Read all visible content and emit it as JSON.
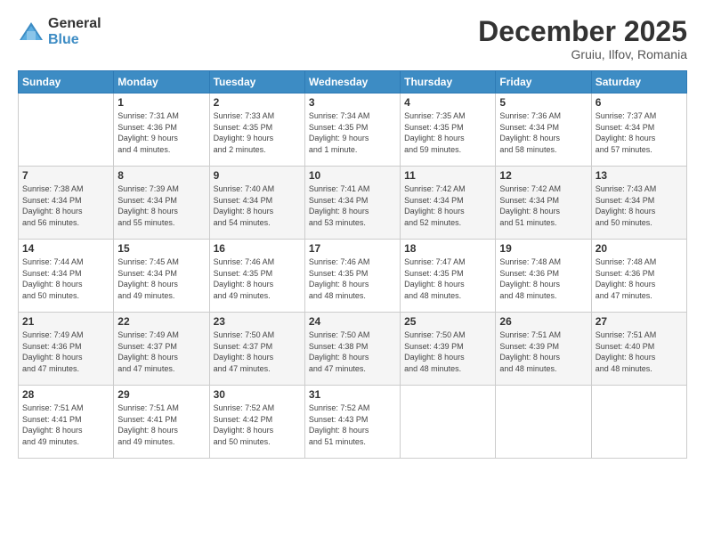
{
  "logo": {
    "general": "General",
    "blue": "Blue"
  },
  "header": {
    "month": "December 2025",
    "location": "Gruiu, Ilfov, Romania"
  },
  "weekdays": [
    "Sunday",
    "Monday",
    "Tuesday",
    "Wednesday",
    "Thursday",
    "Friday",
    "Saturday"
  ],
  "weeks": [
    [
      {
        "day": "",
        "info": ""
      },
      {
        "day": "1",
        "info": "Sunrise: 7:31 AM\nSunset: 4:36 PM\nDaylight: 9 hours\nand 4 minutes."
      },
      {
        "day": "2",
        "info": "Sunrise: 7:33 AM\nSunset: 4:35 PM\nDaylight: 9 hours\nand 2 minutes."
      },
      {
        "day": "3",
        "info": "Sunrise: 7:34 AM\nSunset: 4:35 PM\nDaylight: 9 hours\nand 1 minute."
      },
      {
        "day": "4",
        "info": "Sunrise: 7:35 AM\nSunset: 4:35 PM\nDaylight: 8 hours\nand 59 minutes."
      },
      {
        "day": "5",
        "info": "Sunrise: 7:36 AM\nSunset: 4:34 PM\nDaylight: 8 hours\nand 58 minutes."
      },
      {
        "day": "6",
        "info": "Sunrise: 7:37 AM\nSunset: 4:34 PM\nDaylight: 8 hours\nand 57 minutes."
      }
    ],
    [
      {
        "day": "7",
        "info": "Sunrise: 7:38 AM\nSunset: 4:34 PM\nDaylight: 8 hours\nand 56 minutes."
      },
      {
        "day": "8",
        "info": "Sunrise: 7:39 AM\nSunset: 4:34 PM\nDaylight: 8 hours\nand 55 minutes."
      },
      {
        "day": "9",
        "info": "Sunrise: 7:40 AM\nSunset: 4:34 PM\nDaylight: 8 hours\nand 54 minutes."
      },
      {
        "day": "10",
        "info": "Sunrise: 7:41 AM\nSunset: 4:34 PM\nDaylight: 8 hours\nand 53 minutes."
      },
      {
        "day": "11",
        "info": "Sunrise: 7:42 AM\nSunset: 4:34 PM\nDaylight: 8 hours\nand 52 minutes."
      },
      {
        "day": "12",
        "info": "Sunrise: 7:42 AM\nSunset: 4:34 PM\nDaylight: 8 hours\nand 51 minutes."
      },
      {
        "day": "13",
        "info": "Sunrise: 7:43 AM\nSunset: 4:34 PM\nDaylight: 8 hours\nand 50 minutes."
      }
    ],
    [
      {
        "day": "14",
        "info": "Sunrise: 7:44 AM\nSunset: 4:34 PM\nDaylight: 8 hours\nand 50 minutes."
      },
      {
        "day": "15",
        "info": "Sunrise: 7:45 AM\nSunset: 4:34 PM\nDaylight: 8 hours\nand 49 minutes."
      },
      {
        "day": "16",
        "info": "Sunrise: 7:46 AM\nSunset: 4:35 PM\nDaylight: 8 hours\nand 49 minutes."
      },
      {
        "day": "17",
        "info": "Sunrise: 7:46 AM\nSunset: 4:35 PM\nDaylight: 8 hours\nand 48 minutes."
      },
      {
        "day": "18",
        "info": "Sunrise: 7:47 AM\nSunset: 4:35 PM\nDaylight: 8 hours\nand 48 minutes."
      },
      {
        "day": "19",
        "info": "Sunrise: 7:48 AM\nSunset: 4:36 PM\nDaylight: 8 hours\nand 48 minutes."
      },
      {
        "day": "20",
        "info": "Sunrise: 7:48 AM\nSunset: 4:36 PM\nDaylight: 8 hours\nand 47 minutes."
      }
    ],
    [
      {
        "day": "21",
        "info": "Sunrise: 7:49 AM\nSunset: 4:36 PM\nDaylight: 8 hours\nand 47 minutes."
      },
      {
        "day": "22",
        "info": "Sunrise: 7:49 AM\nSunset: 4:37 PM\nDaylight: 8 hours\nand 47 minutes."
      },
      {
        "day": "23",
        "info": "Sunrise: 7:50 AM\nSunset: 4:37 PM\nDaylight: 8 hours\nand 47 minutes."
      },
      {
        "day": "24",
        "info": "Sunrise: 7:50 AM\nSunset: 4:38 PM\nDaylight: 8 hours\nand 47 minutes."
      },
      {
        "day": "25",
        "info": "Sunrise: 7:50 AM\nSunset: 4:39 PM\nDaylight: 8 hours\nand 48 minutes."
      },
      {
        "day": "26",
        "info": "Sunrise: 7:51 AM\nSunset: 4:39 PM\nDaylight: 8 hours\nand 48 minutes."
      },
      {
        "day": "27",
        "info": "Sunrise: 7:51 AM\nSunset: 4:40 PM\nDaylight: 8 hours\nand 48 minutes."
      }
    ],
    [
      {
        "day": "28",
        "info": "Sunrise: 7:51 AM\nSunset: 4:41 PM\nDaylight: 8 hours\nand 49 minutes."
      },
      {
        "day": "29",
        "info": "Sunrise: 7:51 AM\nSunset: 4:41 PM\nDaylight: 8 hours\nand 49 minutes."
      },
      {
        "day": "30",
        "info": "Sunrise: 7:52 AM\nSunset: 4:42 PM\nDaylight: 8 hours\nand 50 minutes."
      },
      {
        "day": "31",
        "info": "Sunrise: 7:52 AM\nSunset: 4:43 PM\nDaylight: 8 hours\nand 51 minutes."
      },
      {
        "day": "",
        "info": ""
      },
      {
        "day": "",
        "info": ""
      },
      {
        "day": "",
        "info": ""
      }
    ]
  ]
}
